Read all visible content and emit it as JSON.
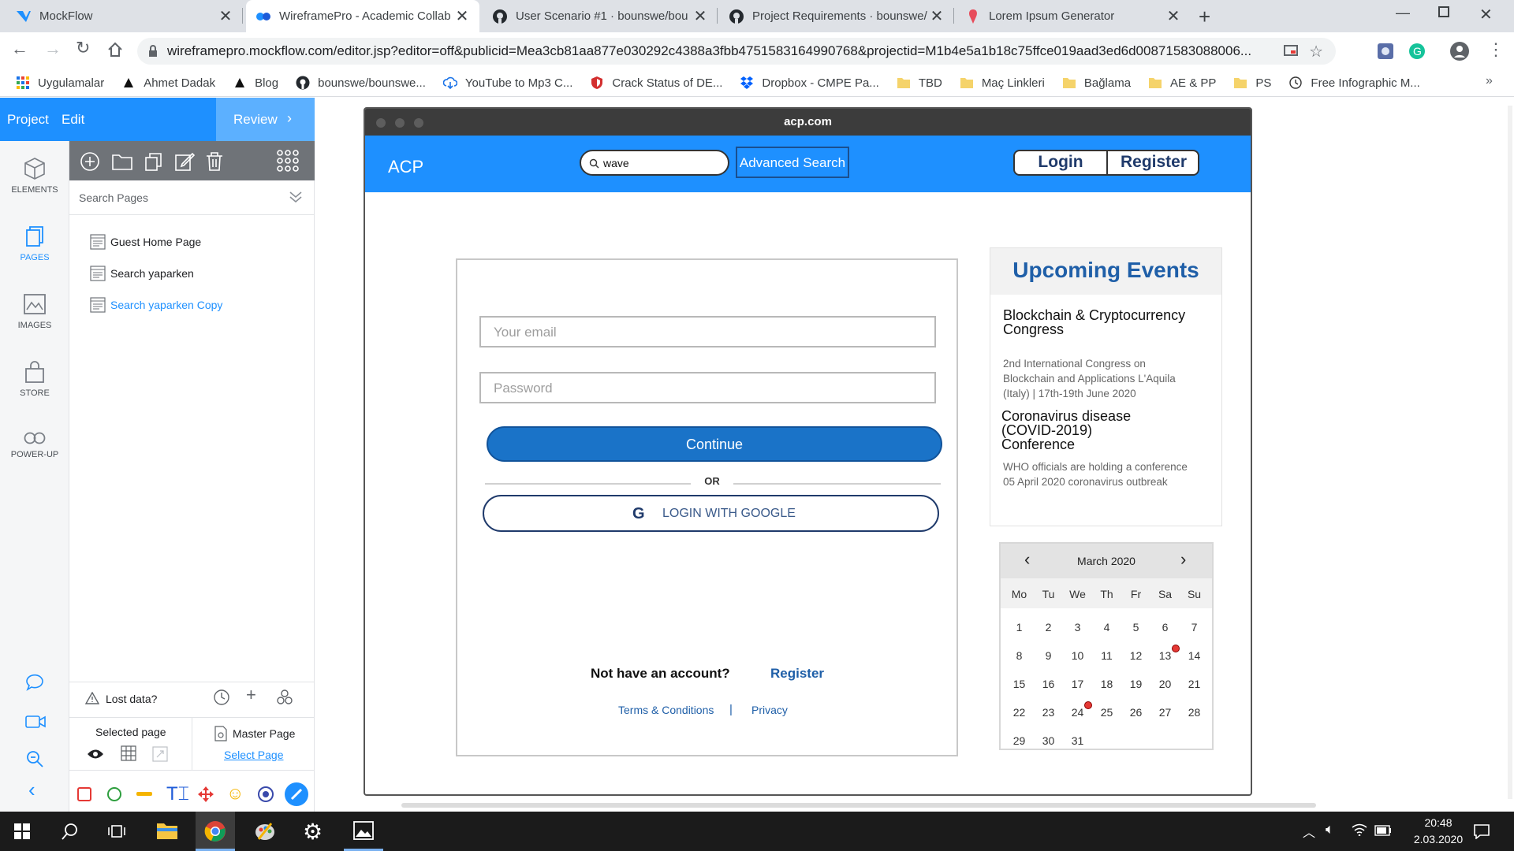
{
  "browser": {
    "tabs": [
      {
        "label": "MockFlow",
        "icon": "mockflow-icon"
      },
      {
        "label": "WireframePro - Academic Collab",
        "icon": "wireframepro-icon"
      },
      {
        "label": "User Scenario #1 · bounswe/bou",
        "icon": "github-icon"
      },
      {
        "label": "Project Requirements · bounswe/",
        "icon": "github-icon"
      },
      {
        "label": "Lorem Ipsum Generator",
        "icon": "lorem-icon"
      }
    ],
    "url": "wireframepro.mockflow.com/editor.jsp?editor=off&publicid=Mea3cb81aa877e030292c4388a3fbb4751583164990768&projectid=M1b4e5a1b18c75ffce019aad3ed6d00871583088006...",
    "bookmarks": [
      {
        "label": "Uygulamalar",
        "icon": "apps-grid-icon"
      },
      {
        "label": "Ahmet Dadak",
        "icon": "triangle-icon"
      },
      {
        "label": "Blog",
        "icon": "triangle-icon"
      },
      {
        "label": "bounswe/bounswe...",
        "icon": "github-icon"
      },
      {
        "label": "YouTube to Mp3 C...",
        "icon": "download-cloud-icon"
      },
      {
        "label": "Crack Status of DE...",
        "icon": "shield-icon"
      },
      {
        "label": "Dropbox - CMPE Pa...",
        "icon": "dropbox-icon"
      },
      {
        "label": "TBD",
        "icon": "folder-icon"
      },
      {
        "label": "Maç Linkleri",
        "icon": "folder-icon"
      },
      {
        "label": "Bağlama",
        "icon": "folder-icon"
      },
      {
        "label": "AE & PP",
        "icon": "folder-icon"
      },
      {
        "label": "PS",
        "icon": "folder-icon"
      },
      {
        "label": "Free Infographic M...",
        "icon": "globe-icon"
      }
    ]
  },
  "editor": {
    "menu": {
      "project": "Project",
      "edit": "Edit",
      "review": "Review"
    },
    "rail": [
      {
        "label": "ELEMENTS",
        "icon": "cube-icon",
        "active": false
      },
      {
        "label": "PAGES",
        "icon": "pages-icon",
        "active": true
      },
      {
        "label": "IMAGES",
        "icon": "image-icon",
        "active": false
      },
      {
        "label": "STORE",
        "icon": "bag-icon",
        "active": false
      },
      {
        "label": "POWER-UP",
        "icon": "infinity-icon",
        "active": false
      }
    ],
    "search_pages": "Search Pages",
    "pages": [
      {
        "label": "Guest Home Page",
        "selected": false
      },
      {
        "label": "Search yaparken",
        "selected": false
      },
      {
        "label": "Search yaparken Copy",
        "selected": true
      }
    ],
    "footer": {
      "lost_data": "Lost data?",
      "selected_page": "Selected page",
      "master_page": "Master Page",
      "select_page": "Select Page"
    }
  },
  "mock": {
    "window_title": "acp.com",
    "brand": "ACP",
    "search_value": "wave",
    "advanced_search": "Advanced Search",
    "login": "Login",
    "register": "Register",
    "form": {
      "email_placeholder": "Your email",
      "password_placeholder": "Password",
      "continue": "Continue",
      "or": "OR",
      "google": "LOGIN WITH GOOGLE",
      "no_account": "Not have an account?",
      "register_link": "Register",
      "terms": "Terms & Conditions",
      "divider": "|",
      "privacy": "Privacy"
    },
    "events": {
      "title": "Upcoming Events",
      "items": [
        {
          "title": "Blockchain & Cryptocurrency Congress",
          "desc": "2nd International Congress on Blockchain and Applications L'Aquila (Italy) | 17th-19th June 2020"
        },
        {
          "title": "Coronavirus disease (COVID-2019) Conference",
          "desc": "WHO officials are holding a conference 05 April 2020 coronavirus outbreak"
        }
      ]
    },
    "calendar": {
      "month": "March 2020",
      "weekdays": [
        "Mo",
        "Tu",
        "We",
        "Th",
        "Fr",
        "Sa",
        "Su"
      ],
      "weeks": [
        [
          "1",
          "2",
          "3",
          "4",
          "5",
          "6",
          "7"
        ],
        [
          "8",
          "9",
          "10",
          "11",
          "12",
          "13",
          "14"
        ],
        [
          "15",
          "16",
          "17",
          "18",
          "19",
          "20",
          "21"
        ],
        [
          "22",
          "23",
          "24",
          "25",
          "26",
          "27",
          "28"
        ],
        [
          "29",
          "30",
          "31",
          "",
          "",
          "",
          ""
        ]
      ],
      "event_days": [
        "13",
        "24"
      ],
      "event_color": "#e53935"
    }
  },
  "taskbar": {
    "time": "20:48",
    "date": "2.03.2020"
  },
  "colors": {
    "accent": "#1e90ff",
    "button": "#1a73c8",
    "mock_text": "#1f5fa8"
  }
}
